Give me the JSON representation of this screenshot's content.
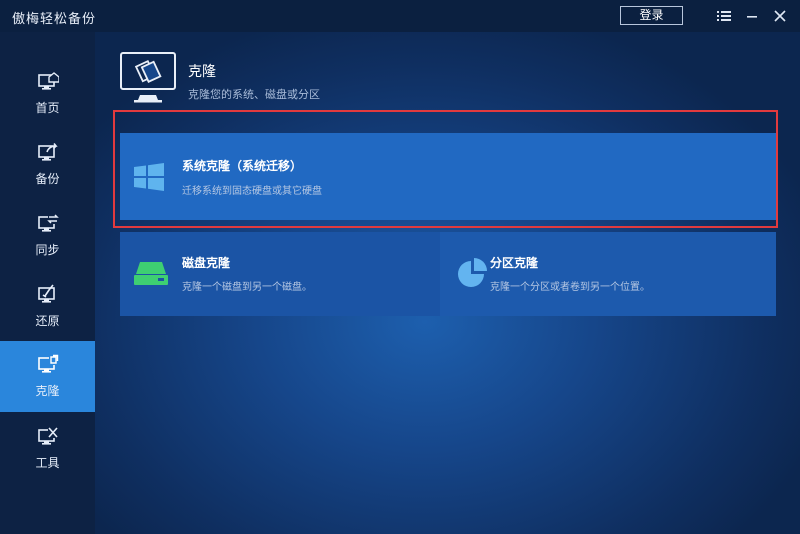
{
  "app": {
    "title": "傲梅轻松备份",
    "login_label": "登录"
  },
  "sidebar": {
    "items": [
      {
        "label": "首页",
        "icon": "home-icon"
      },
      {
        "label": "备份",
        "icon": "backup-icon"
      },
      {
        "label": "同步",
        "icon": "sync-icon"
      },
      {
        "label": "还原",
        "icon": "restore-icon"
      },
      {
        "label": "克隆",
        "icon": "clone-icon",
        "active": true
      },
      {
        "label": "工具",
        "icon": "tools-icon"
      }
    ]
  },
  "main": {
    "title": "克隆",
    "subtitle": "克隆您的系统、磁盘或分区",
    "cards": [
      {
        "title": "系统克隆（系统迁移）",
        "desc": "迁移系统到固态硬盘或其它硬盘",
        "icon": "windows-icon"
      },
      {
        "title": "磁盘克隆",
        "desc": "克隆一个磁盘到另一个磁盘。",
        "icon": "disk-icon"
      },
      {
        "title": "分区克隆",
        "desc": "克隆一个分区或者卷到另一个位置。",
        "icon": "pie-icon"
      }
    ]
  },
  "colors": {
    "accent": "#2a86dc",
    "highlight": "#e23a3e",
    "disk_green": "#3ecf72",
    "pie_blue": "#63b4f0"
  }
}
